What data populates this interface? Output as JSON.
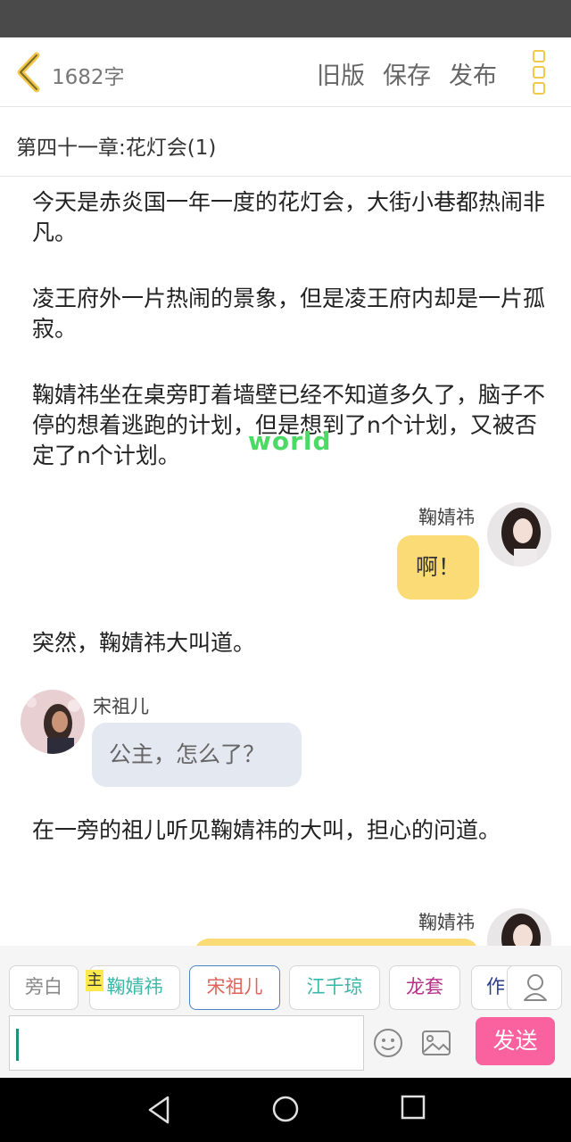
{
  "header": {
    "word_count": "1682字",
    "old_version_label": "旧版",
    "save_label": "保存",
    "publish_label": "发布",
    "icons": [
      "chevron-left-icon",
      "more-vertical-icon"
    ],
    "accent_color": "#f2c84b"
  },
  "chapter": {
    "title": "第四十一章:花灯会(1)"
  },
  "story": {
    "paragraphs": [
      "今天是赤炎国一年一度的花灯会，大街小巷都热闹非凡。",
      "凌王府外一片热闹的景象，但是凌王府内却是一片孤寂。",
      "鞠婧祎坐在桌旁盯着墙壁已经不知道多久了，脑子不停的想着逃跑的计划，但是想到了n个计划，又被否定了n个计划。",
      "突然，鞠婧祎大叫道。",
      "在一旁的祖儿听见鞠婧祎的大叫，担心的问道。"
    ],
    "watermark": "world",
    "messages": [
      {
        "speaker": "鞠婧祎",
        "text": "啊！",
        "side": "right"
      },
      {
        "speaker": "宋祖儿",
        "text": "公主，怎么了？",
        "side": "left"
      },
      {
        "speaker": "鞠婧祎",
        "text": "",
        "side": "right"
      }
    ]
  },
  "characters": {
    "narration": "旁白",
    "main_tag": "主",
    "list": [
      "鞠婧祎",
      "宋祖儿",
      "江千琼",
      "龙套",
      "作"
    ],
    "colors": [
      "#3cb6a8",
      "#e2635b",
      "#3cb6a8",
      "#b8318a",
      "#2c3e8c"
    ]
  },
  "composer": {
    "input_value": "",
    "send_label": "发送",
    "icons": [
      "emoji-icon",
      "image-icon",
      "user-icon"
    ],
    "send_color": "#f9629f"
  },
  "system_nav": {
    "icons": [
      "back-icon",
      "home-icon",
      "recents-icon"
    ]
  }
}
